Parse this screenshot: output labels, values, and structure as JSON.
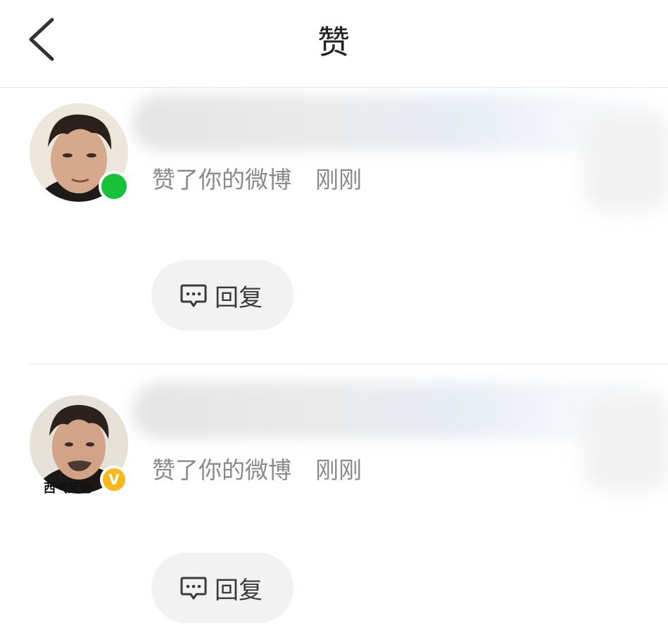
{
  "header": {
    "title": "赞",
    "back_icon": "chevron-left-icon"
  },
  "notifications": [
    {
      "username": "",
      "action": "赞了你的微博",
      "time": "刚刚",
      "badge": "online-dot",
      "badge_color": "#19c13a",
      "avatar_caption": "",
      "reply_label": "回复",
      "reply_icon": "comment-bubble-icon"
    },
    {
      "username": "",
      "action": "赞了你的微博",
      "time": "刚刚",
      "badge": "verified-v",
      "badge_text": "V",
      "badge_color": "#f6b81c",
      "avatar_caption": "西气死爸",
      "reply_label": "回复",
      "reply_icon": "comment-bubble-icon"
    }
  ],
  "colors": {
    "text_primary": "#222222",
    "text_secondary": "#8a8a8a",
    "button_bg": "#f2f2f2",
    "divider": "#e8e8e8"
  }
}
